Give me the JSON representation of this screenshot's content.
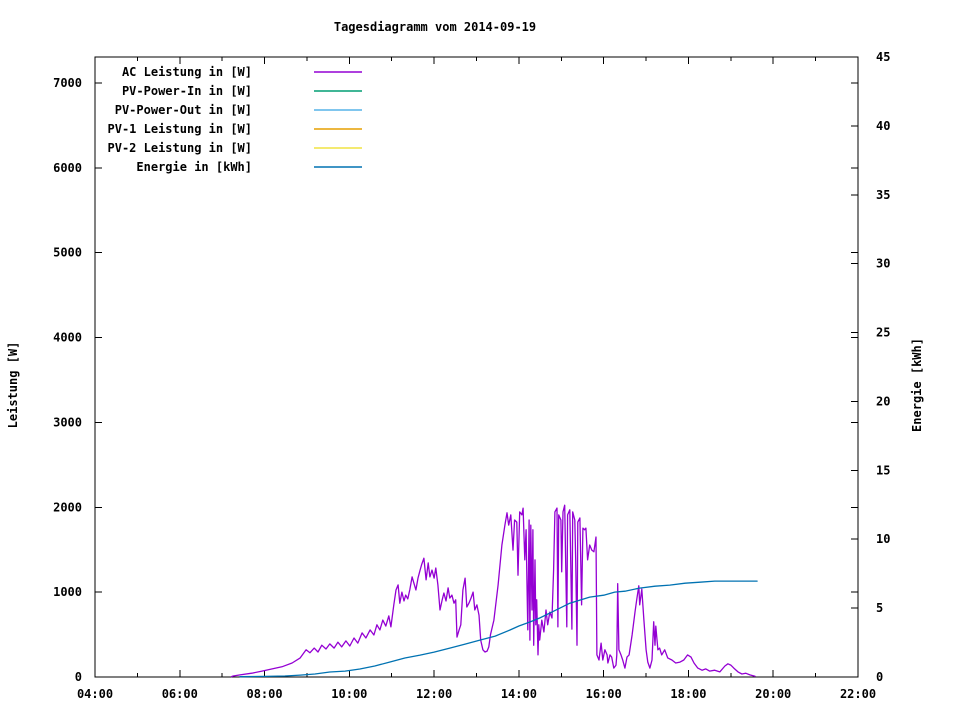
{
  "title": "Tagesdiagramm vom 2014-09-19",
  "axes": {
    "x": {
      "min": 4,
      "max": 22,
      "major_step": 2,
      "minor_step": 1,
      "tick_labels": [
        "04:00",
        "06:00",
        "08:00",
        "10:00",
        "12:00",
        "14:00",
        "16:00",
        "18:00",
        "20:00",
        "22:00"
      ]
    },
    "y_left": {
      "label": "Leistung [W]",
      "tick_min": 0,
      "tick_max": 7000,
      "tick_step": 1000,
      "axis_max": 7306
    },
    "y_right": {
      "label": "Energie [kWh]",
      "tick_min": 0,
      "tick_max": 45,
      "tick_step": 5,
      "axis_max": 45
    }
  },
  "chart_data": {
    "type": "line",
    "title": "Tagesdiagramm vom 2014-09-19",
    "xlabel": "",
    "x_unit": "hour_of_day",
    "x_range": [
      4,
      22
    ],
    "y_left_range": [
      0,
      7306
    ],
    "y_right_range": [
      0,
      45
    ],
    "grid": false,
    "legend_position": "top-left-inside",
    "series": [
      {
        "id": "ac-power",
        "name": "AC Leistung in [W]",
        "color": "#9400d3",
        "axis": "left",
        "unit": "W",
        "points": [
          [
            7.22,
            5
          ],
          [
            7.26,
            12
          ],
          [
            7.42,
            25
          ],
          [
            7.7,
            45
          ],
          [
            7.94,
            70
          ],
          [
            8.18,
            95
          ],
          [
            8.41,
            120
          ],
          [
            8.65,
            165
          ],
          [
            8.84,
            225
          ],
          [
            8.98,
            320
          ],
          [
            9.07,
            285
          ],
          [
            9.17,
            340
          ],
          [
            9.26,
            295
          ],
          [
            9.35,
            375
          ],
          [
            9.45,
            330
          ],
          [
            9.54,
            390
          ],
          [
            9.64,
            340
          ],
          [
            9.73,
            410
          ],
          [
            9.82,
            355
          ],
          [
            9.92,
            425
          ],
          [
            10.01,
            365
          ],
          [
            10.11,
            460
          ],
          [
            10.2,
            400
          ],
          [
            10.3,
            520
          ],
          [
            10.39,
            460
          ],
          [
            10.49,
            555
          ],
          [
            10.58,
            495
          ],
          [
            10.65,
            615
          ],
          [
            10.72,
            555
          ],
          [
            10.79,
            670
          ],
          [
            10.86,
            600
          ],
          [
            10.93,
            720
          ],
          [
            10.98,
            590
          ],
          [
            11.05,
            850
          ],
          [
            11.1,
            1025
          ],
          [
            11.15,
            1085
          ],
          [
            11.19,
            870
          ],
          [
            11.24,
            1000
          ],
          [
            11.29,
            895
          ],
          [
            11.33,
            965
          ],
          [
            11.38,
            920
          ],
          [
            11.43,
            1035
          ],
          [
            11.48,
            1180
          ],
          [
            11.52,
            1110
          ],
          [
            11.57,
            1025
          ],
          [
            11.62,
            1165
          ],
          [
            11.67,
            1260
          ],
          [
            11.71,
            1330
          ],
          [
            11.76,
            1400
          ],
          [
            11.81,
            1145
          ],
          [
            11.86,
            1345
          ],
          [
            11.9,
            1180
          ],
          [
            11.95,
            1260
          ],
          [
            12.0,
            1165
          ],
          [
            12.04,
            1285
          ],
          [
            12.09,
            1085
          ],
          [
            12.14,
            790
          ],
          [
            12.19,
            910
          ],
          [
            12.23,
            990
          ],
          [
            12.28,
            895
          ],
          [
            12.33,
            1050
          ],
          [
            12.37,
            930
          ],
          [
            12.42,
            965
          ],
          [
            12.47,
            870
          ],
          [
            12.51,
            910
          ],
          [
            12.54,
            470
          ],
          [
            12.59,
            555
          ],
          [
            12.63,
            615
          ],
          [
            12.68,
            1025
          ],
          [
            12.73,
            1165
          ],
          [
            12.77,
            825
          ],
          [
            12.82,
            870
          ],
          [
            12.87,
            930
          ],
          [
            12.92,
            1000
          ],
          [
            12.96,
            790
          ],
          [
            13.01,
            850
          ],
          [
            13.06,
            730
          ],
          [
            13.1,
            435
          ],
          [
            13.15,
            320
          ],
          [
            13.2,
            295
          ],
          [
            13.25,
            305
          ],
          [
            13.29,
            355
          ],
          [
            13.33,
            500
          ],
          [
            13.41,
            670
          ],
          [
            13.51,
            1085
          ],
          [
            13.6,
            1555
          ],
          [
            13.67,
            1790
          ],
          [
            13.72,
            1935
          ],
          [
            13.76,
            1790
          ],
          [
            13.81,
            1910
          ],
          [
            13.86,
            1495
          ],
          [
            13.9,
            1850
          ],
          [
            13.95,
            1825
          ],
          [
            13.98,
            1200
          ],
          [
            14.02,
            1945
          ],
          [
            14.07,
            1910
          ],
          [
            14.1,
            1990
          ],
          [
            14.14,
            1380
          ],
          [
            14.17,
            1735
          ],
          [
            14.19,
            1145
          ],
          [
            14.21,
            555
          ],
          [
            14.24,
            1850
          ],
          [
            14.26,
            435
          ],
          [
            14.28,
            1790
          ],
          [
            14.31,
            790
          ],
          [
            14.33,
            1735
          ],
          [
            14.35,
            375
          ],
          [
            14.38,
            1380
          ],
          [
            14.4,
            615
          ],
          [
            14.42,
            910
          ],
          [
            14.45,
            260
          ],
          [
            14.47,
            615
          ],
          [
            14.49,
            435
          ],
          [
            14.54,
            670
          ],
          [
            14.59,
            530
          ],
          [
            14.64,
            790
          ],
          [
            14.68,
            615
          ],
          [
            14.73,
            765
          ],
          [
            14.78,
            695
          ],
          [
            14.82,
            1260
          ],
          [
            14.85,
            1945
          ],
          [
            14.9,
            1990
          ],
          [
            14.92,
            590
          ],
          [
            14.94,
            1910
          ],
          [
            14.99,
            1850
          ],
          [
            15.01,
            1240
          ],
          [
            15.04,
            1945
          ],
          [
            15.08,
            2025
          ],
          [
            15.11,
            1200
          ],
          [
            15.13,
            590
          ],
          [
            15.15,
            1910
          ],
          [
            15.2,
            1970
          ],
          [
            15.25,
            565
          ],
          [
            15.27,
            1945
          ],
          [
            15.32,
            1850
          ],
          [
            15.34,
            1380
          ],
          [
            15.37,
            375
          ],
          [
            15.39,
            1825
          ],
          [
            15.44,
            1875
          ],
          [
            15.48,
            850
          ],
          [
            15.51,
            1755
          ],
          [
            15.55,
            1735
          ],
          [
            15.58,
            1755
          ],
          [
            15.62,
            1380
          ],
          [
            15.67,
            1555
          ],
          [
            15.72,
            1495
          ],
          [
            15.77,
            1475
          ],
          [
            15.82,
            1650
          ],
          [
            15.84,
            260
          ],
          [
            15.89,
            200
          ],
          [
            15.94,
            400
          ],
          [
            15.98,
            200
          ],
          [
            16.03,
            320
          ],
          [
            16.08,
            260
          ],
          [
            16.1,
            165
          ],
          [
            16.15,
            260
          ],
          [
            16.19,
            235
          ],
          [
            16.24,
            105
          ],
          [
            16.29,
            140
          ],
          [
            16.31,
            260
          ],
          [
            16.33,
            1100
          ],
          [
            16.36,
            320
          ],
          [
            16.41,
            260
          ],
          [
            16.45,
            200
          ],
          [
            16.5,
            105
          ],
          [
            16.55,
            235
          ],
          [
            16.6,
            260
          ],
          [
            16.67,
            495
          ],
          [
            16.74,
            765
          ],
          [
            16.78,
            910
          ],
          [
            16.83,
            1075
          ],
          [
            16.85,
            850
          ],
          [
            16.9,
            1035
          ],
          [
            16.95,
            670
          ],
          [
            17.0,
            320
          ],
          [
            17.04,
            175
          ],
          [
            17.09,
            105
          ],
          [
            17.14,
            200
          ],
          [
            17.18,
            650
          ],
          [
            17.21,
            375
          ],
          [
            17.23,
            600
          ],
          [
            17.28,
            320
          ],
          [
            17.32,
            340
          ],
          [
            17.37,
            260
          ],
          [
            17.44,
            320
          ],
          [
            17.51,
            225
          ],
          [
            17.61,
            200
          ],
          [
            17.7,
            165
          ],
          [
            17.8,
            175
          ],
          [
            17.89,
            200
          ],
          [
            17.98,
            260
          ],
          [
            18.06,
            235
          ],
          [
            18.13,
            165
          ],
          [
            18.22,
            105
          ],
          [
            18.32,
            80
          ],
          [
            18.41,
            95
          ],
          [
            18.5,
            70
          ],
          [
            18.62,
            80
          ],
          [
            18.74,
            60
          ],
          [
            18.86,
            130
          ],
          [
            18.93,
            155
          ],
          [
            19.0,
            140
          ],
          [
            19.07,
            105
          ],
          [
            19.17,
            60
          ],
          [
            19.26,
            35
          ],
          [
            19.35,
            45
          ],
          [
            19.45,
            25
          ],
          [
            19.57,
            10
          ]
        ]
      },
      {
        "id": "pv-power-in",
        "name": "PV-Power-In in [W]",
        "color": "#009e73",
        "axis": "left",
        "unit": "W",
        "points": []
      },
      {
        "id": "pv-power-out",
        "name": "PV-Power-Out in [W]",
        "color": "#56b4e9",
        "axis": "left",
        "unit": "W",
        "points": []
      },
      {
        "id": "pv1-power",
        "name": "PV-1 Leistung in [W]",
        "color": "#e69f00",
        "axis": "left",
        "unit": "W",
        "points": []
      },
      {
        "id": "pv2-power",
        "name": "PV-2 Leistung in [W]",
        "color": "#f0e442",
        "axis": "left",
        "unit": "W",
        "points": []
      },
      {
        "id": "energy",
        "name": "Energie in [kWh]",
        "color": "#0072b2",
        "axis": "right",
        "unit": "kWh",
        "points": [
          [
            7.42,
            0.02
          ],
          [
            8.0,
            0.04
          ],
          [
            8.48,
            0.07
          ],
          [
            8.84,
            0.14
          ],
          [
            9.19,
            0.22
          ],
          [
            9.54,
            0.36
          ],
          [
            9.9,
            0.43
          ],
          [
            10.25,
            0.58
          ],
          [
            10.6,
            0.8
          ],
          [
            10.96,
            1.09
          ],
          [
            11.31,
            1.38
          ],
          [
            11.67,
            1.59
          ],
          [
            12.0,
            1.81
          ],
          [
            12.37,
            2.1
          ],
          [
            12.73,
            2.39
          ],
          [
            13.08,
            2.68
          ],
          [
            13.44,
            2.97
          ],
          [
            13.79,
            3.41
          ],
          [
            14.0,
            3.7
          ],
          [
            14.26,
            3.99
          ],
          [
            14.49,
            4.28
          ],
          [
            14.73,
            4.64
          ],
          [
            14.97,
            5.0
          ],
          [
            15.2,
            5.36
          ],
          [
            15.44,
            5.58
          ],
          [
            15.67,
            5.8
          ],
          [
            16.0,
            5.94
          ],
          [
            16.26,
            6.16
          ],
          [
            16.5,
            6.23
          ],
          [
            16.85,
            6.45
          ],
          [
            17.21,
            6.59
          ],
          [
            17.56,
            6.67
          ],
          [
            17.92,
            6.81
          ],
          [
            18.27,
            6.88
          ],
          [
            18.62,
            6.96
          ],
          [
            19.0,
            6.96
          ],
          [
            19.33,
            6.96
          ],
          [
            19.62,
            6.96
          ]
        ]
      }
    ]
  }
}
